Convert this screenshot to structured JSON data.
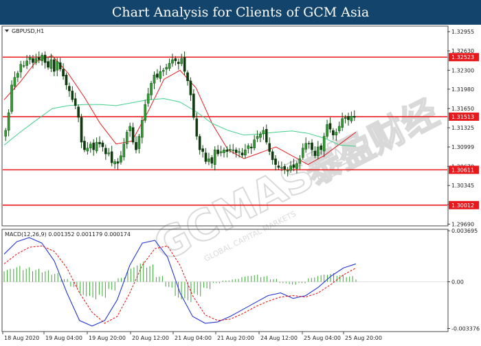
{
  "header": {
    "title": "Chart Analysis for Clients of GCM Asia"
  },
  "watermark": {
    "brand": "GCMASIA",
    "script": "泰盈财经",
    "tagline": "GLOBAL CAPITAL MARKETS"
  },
  "chart_data": [
    {
      "type": "candlestick",
      "symbol_label": "GBPUSD,H1",
      "y_ticks": [
        "1.32955",
        "1.32630",
        "1.32300",
        "1.31980",
        "1.31650",
        "1.31325",
        "1.30999",
        "1.30670",
        "1.30345",
        "1.30020",
        "1.29690"
      ],
      "ylim": [
        1.2966,
        1.3305
      ],
      "levels": [
        {
          "value": 1.32523,
          "label": "1.32523"
        },
        {
          "value": 1.31513,
          "label": "1.31513"
        },
        {
          "value": 1.30611,
          "label": "1.30611"
        },
        {
          "value": 1.30012,
          "label": "1.30012"
        }
      ],
      "x_ticks": [
        "18 Aug 2020",
        "19 Aug 04:00",
        "19 Aug 20:00",
        "20 Aug 12:00",
        "21 Aug 04:00",
        "21 Aug 20:00",
        "24 Aug 12:00",
        "25 Aug 04:00",
        "25 Aug 20:00"
      ],
      "candles_close": [
        1.3128,
        1.3158,
        1.3205,
        1.3218,
        1.3225,
        1.324,
        1.3238,
        1.3246,
        1.3252,
        1.3243,
        1.325,
        1.3248,
        1.3256,
        1.3243,
        1.3235,
        1.3248,
        1.3228,
        1.3245,
        1.3232,
        1.322,
        1.3205,
        1.3195,
        1.318,
        1.317,
        1.315,
        1.3108,
        1.3095,
        1.3098,
        1.3105,
        1.3095,
        1.3108,
        1.3105,
        1.31,
        1.3088,
        1.309,
        1.3073,
        1.3075,
        1.3072,
        1.3085,
        1.3105,
        1.3125,
        1.3135,
        1.3108,
        1.3095,
        1.3118,
        1.3145,
        1.3172,
        1.319,
        1.3208,
        1.3222,
        1.3218,
        1.3228,
        1.323,
        1.3235,
        1.3242,
        1.3248,
        1.3246,
        1.3241,
        1.325,
        1.3228,
        1.3212,
        1.3188,
        1.315,
        1.3118,
        1.3095,
        1.3092,
        1.3075,
        1.308,
        1.3072,
        1.3095,
        1.3088,
        1.3092,
        1.3095,
        1.3092,
        1.3096,
        1.3095,
        1.309,
        1.3092,
        1.3086,
        1.3095,
        1.3102,
        1.3098,
        1.3112,
        1.3118,
        1.3122,
        1.3128,
        1.3108,
        1.3092,
        1.3078,
        1.307,
        1.3065,
        1.3065,
        1.3062,
        1.306,
        1.3068,
        1.3065,
        1.3072,
        1.308,
        1.3098,
        1.3106,
        1.3105,
        1.3095,
        1.3085,
        1.31,
        1.3095,
        1.3118,
        1.3138,
        1.313,
        1.312,
        1.3125,
        1.3135,
        1.3148,
        1.315,
        1.3146,
        1.3152,
        1.315
      ],
      "series": [
        {
          "name": "MA fast",
          "color": "#e8191d",
          "values": [
            1.318,
            1.321,
            1.3245,
            1.3255,
            1.3225,
            1.3185,
            1.314,
            1.3105,
            1.311,
            1.316,
            1.3215,
            1.323,
            1.32,
            1.314,
            1.3095,
            1.308,
            1.309,
            1.31,
            1.3085,
            1.307,
            1.3085,
            1.3105,
            1.3125
          ]
        },
        {
          "name": "MA slow",
          "color": "#3fcf8a",
          "values": [
            1.3103,
            1.3125,
            1.3145,
            1.3165,
            1.317,
            1.3172,
            1.3172,
            1.317,
            1.3175,
            1.318,
            1.3182,
            1.3176,
            1.316,
            1.314,
            1.3128,
            1.312,
            1.3122,
            1.3125,
            1.3127,
            1.3123,
            1.3115,
            1.3103,
            1.3101
          ]
        }
      ]
    },
    {
      "type": "macd",
      "label": "MACD(12,26,9) 0.001352 0.001179 0.000174",
      "y_ticks": [
        "0.003695",
        "0.00",
        "-0.003376"
      ],
      "ylim": [
        -0.0036,
        0.0038
      ],
      "histogram": [
        0.0009,
        0.0011,
        0.001,
        0.0009,
        0.0008,
        0.0006,
        0.0002,
        -0.0004,
        -0.001,
        -0.0012,
        -0.0011,
        -0.0006,
        0.0003,
        0.001,
        0.0014,
        0.0012,
        0.0004,
        -0.0004,
        -0.0012,
        -0.0014,
        -0.001,
        -0.0005,
        -0.0001,
        0.0001,
        0.0002,
        0.0004,
        0.0005,
        0.0004,
        0.0002,
        -0.0001,
        -0.0002,
        -0.0001,
        0.0003,
        0.0005,
        0.0006,
        0.0005,
        0.0004,
        0.0002
      ],
      "series": [
        {
          "name": "MACD",
          "color": "#2336d6",
          "values": [
            0.002,
            0.0029,
            0.0032,
            0.0028,
            0.0015,
            -0.0008,
            -0.0028,
            -0.0032,
            -0.0028,
            -0.0013,
            0.0012,
            0.0028,
            0.003,
            0.0018,
            -0.0008,
            -0.0025,
            -0.003,
            -0.0029,
            -0.0025,
            -0.002,
            -0.0015,
            -0.001,
            -0.0008,
            -0.0012,
            -0.001,
            -0.0004,
            0.0004,
            0.001,
            0.0013
          ]
        },
        {
          "name": "Signal",
          "color": "#e8191d",
          "values": [
            0.0013,
            0.002,
            0.0025,
            0.0026,
            0.0022,
            0.001,
            -0.0008,
            -0.0022,
            -0.003,
            -0.0025,
            -0.0008,
            0.0012,
            0.0024,
            0.0026,
            0.0012,
            -0.001,
            -0.0024,
            -0.0028,
            -0.0027,
            -0.0023,
            -0.0018,
            -0.0014,
            -0.0011,
            -0.001,
            -0.0011,
            -0.0008,
            -0.0002,
            0.0005,
            0.001
          ]
        }
      ]
    }
  ]
}
